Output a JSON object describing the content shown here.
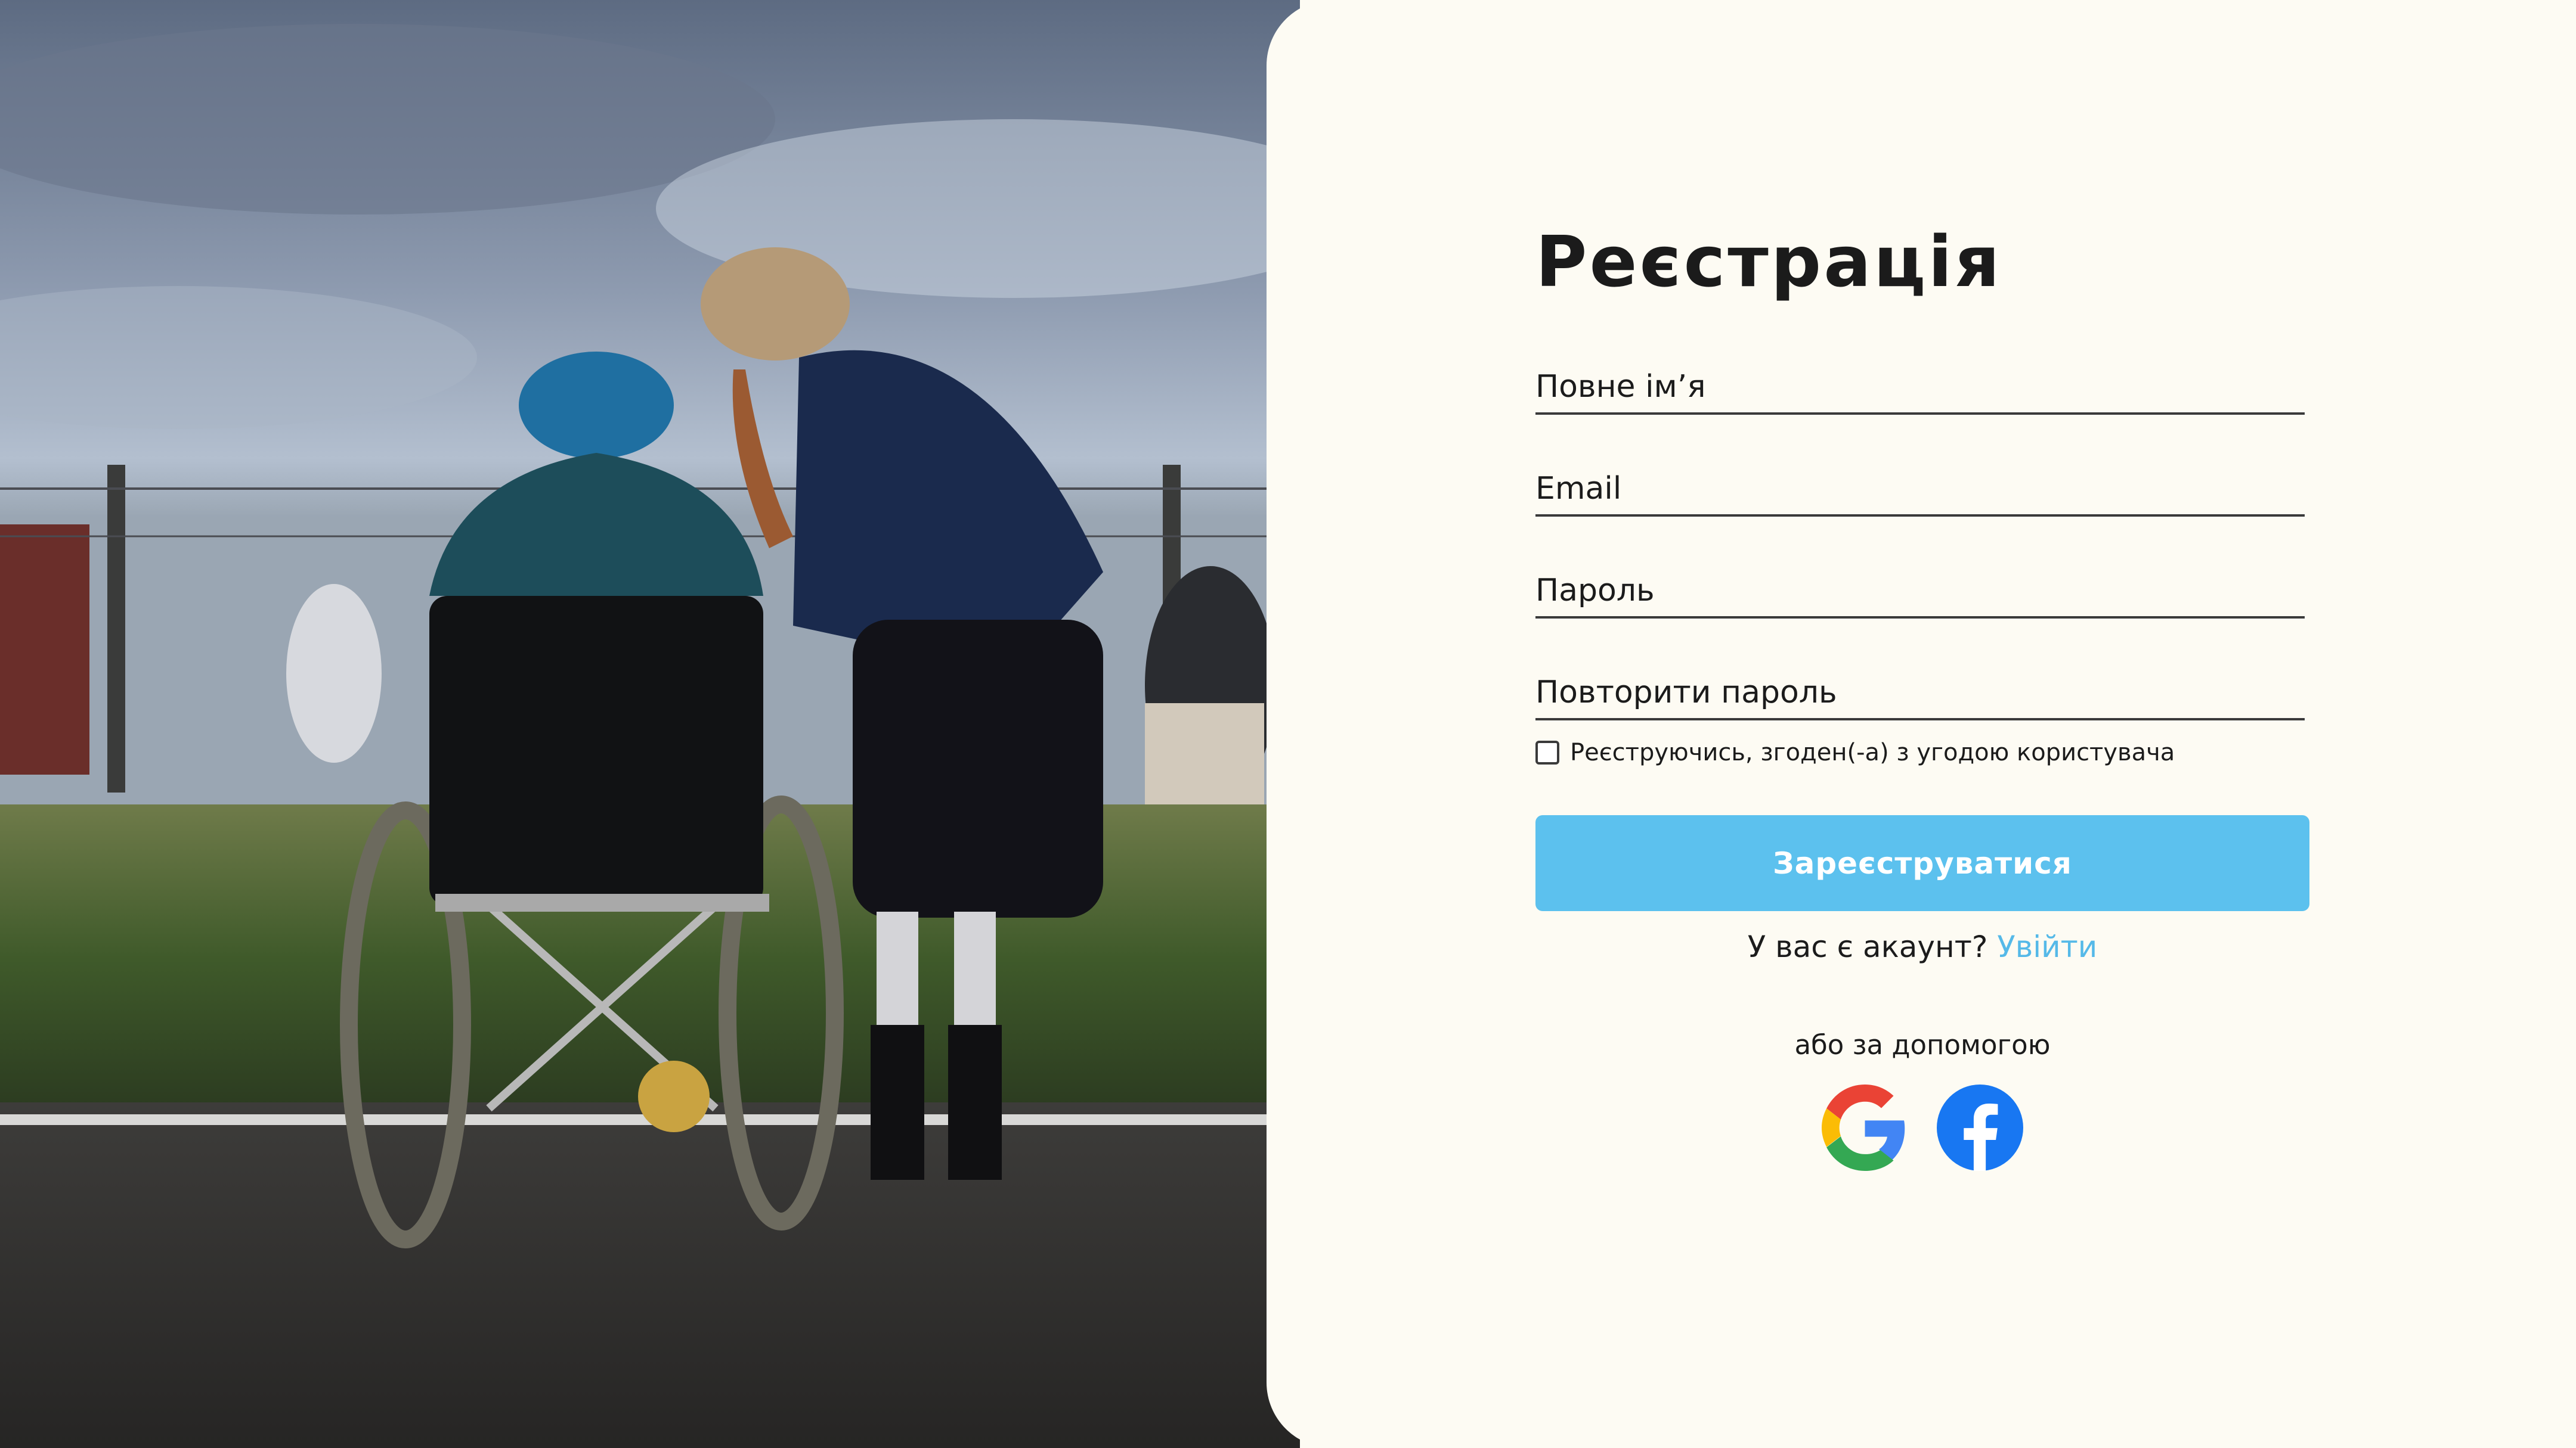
{
  "photo": {
    "description_icon": "photo-wheelchair-caregiver"
  },
  "signup": {
    "title": "Реєстрація",
    "fields": {
      "full_name": {
        "placeholder": "Повне ім’я",
        "value": ""
      },
      "email": {
        "placeholder": "Email",
        "value": ""
      },
      "password": {
        "placeholder": "Пароль",
        "value": ""
      },
      "repeat_password": {
        "placeholder": "Повторити пароль",
        "value": ""
      }
    },
    "agreement_label": "Реєструючись, згоден(-а) з угодою користувача",
    "agreement_checked": false,
    "submit_label": "Зареєструватися",
    "have_account_text": "У вас є акаунт?",
    "login_link": "Увійти",
    "or_via": "або за допомогою",
    "social": [
      {
        "name": "google-icon"
      },
      {
        "name": "facebook-icon"
      }
    ]
  },
  "colors": {
    "panel_background": "#fdfbf3",
    "accent": "#5cc1ee",
    "link": "#55b9e8",
    "text": "#1b1b1b"
  }
}
